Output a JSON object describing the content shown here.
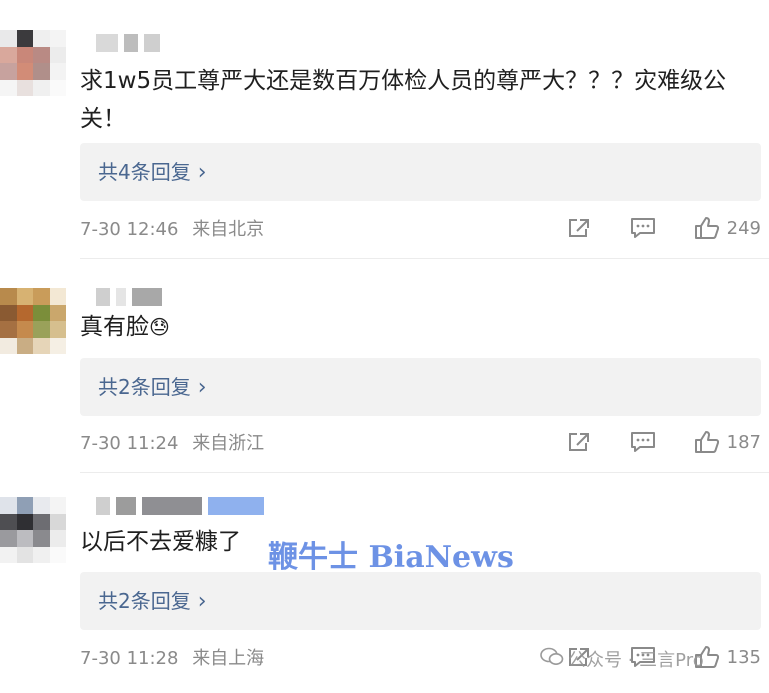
{
  "comments": [
    {
      "text": "求1w5员工尊严大还是数百万体检人员的尊严大？？？灾难级公关！",
      "reply_label": "共4条回复",
      "time": "7-30 12:46",
      "location": "来自北京",
      "likes": "249"
    },
    {
      "text": "真有脸",
      "emoji": "😓",
      "reply_label": "共2条回复",
      "time": "7-30 11:24",
      "location": "来自浙江",
      "likes": "187"
    },
    {
      "text": "以后不去爱糠了",
      "reply_label": "共2条回复",
      "time": "7-30 11:28",
      "location": "来自上海",
      "likes": "135"
    }
  ],
  "watermark": "鞭牛士 BiaNews",
  "mp_mark": {
    "label": "公众号 · 三言Pro"
  },
  "icons": [
    "share-icon",
    "comment-icon",
    "like-icon",
    "wechat-icon"
  ],
  "colors": {
    "link": "#4a6790",
    "meta": "#8a8a8a",
    "reply_bg": "#f2f2f2"
  }
}
